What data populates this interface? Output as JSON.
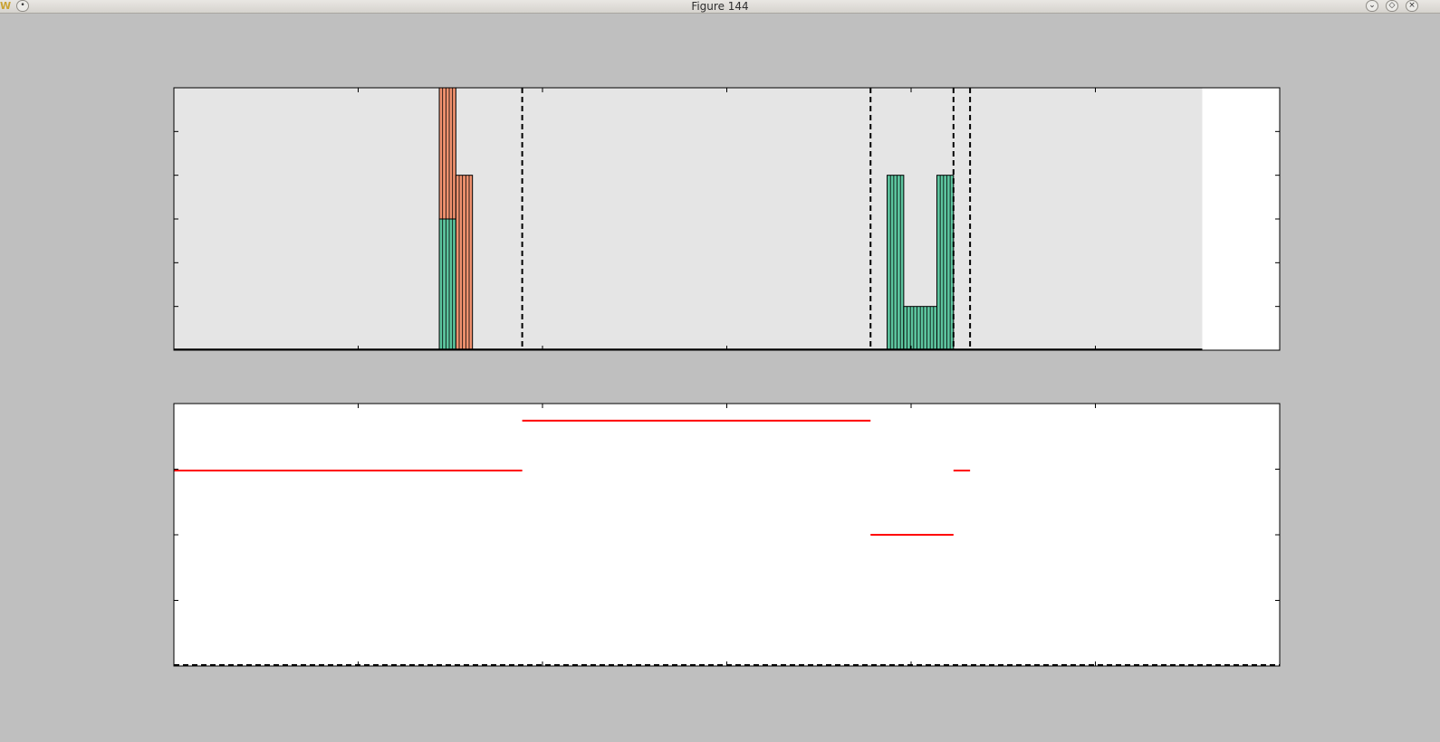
{
  "window": {
    "title": "Figure 144"
  },
  "colors": {
    "figure_bg": "#bfbfbf",
    "upper_axes_bg": "#e5e5e5",
    "coral": "#f0926f",
    "teal": "#5cc49e",
    "red_line": "#ff0000"
  },
  "chart_data": [
    {
      "type": "bar",
      "stacked": true,
      "grid": false,
      "xlim": [
        0,
        120000
      ],
      "ylim": [
        0,
        6000
      ],
      "xticks": [
        "0",
        "20000",
        "40000",
        "60000",
        "80000",
        "100000",
        "120000"
      ],
      "yticks": [
        "0",
        "1000",
        "2000",
        "3000",
        "4000",
        "5000",
        "6000"
      ],
      "shaded_region": [
        0,
        111600
      ],
      "series": [
        {
          "color": "#5cc49e",
          "bars": [
            {
              "x0": 28800,
              "x1": 30600,
              "value": 3000
            },
            {
              "x0": 77400,
              "x1": 79200,
              "value": 4000
            },
            {
              "x0": 79200,
              "x1": 82800,
              "value": 1000
            },
            {
              "x0": 82800,
              "x1": 84600,
              "value": 4000
            }
          ]
        },
        {
          "color": "#f0926f",
          "bars": [
            {
              "x0": 28800,
              "x1": 30600,
              "value": 3000
            },
            {
              "x0": 30600,
              "x1": 32400,
              "value": 4000
            }
          ]
        }
      ],
      "vlines": [
        37800,
        75600,
        84600,
        86400
      ]
    },
    {
      "type": "line",
      "grid": false,
      "xlim": [
        0,
        120000
      ],
      "ylim": [
        0,
        0.2
      ],
      "xticks": [
        "0",
        "20000",
        "40000",
        "60000",
        "80000",
        "100000",
        "120000"
      ],
      "yticks": [
        "0.00",
        "0.05",
        "0.10",
        "0.15",
        "0.20"
      ],
      "segments": [
        {
          "x0": 0,
          "x1": 37800,
          "y": 0.149
        },
        {
          "x0": 37800,
          "x1": 75600,
          "y": 0.187
        },
        {
          "x0": 75600,
          "x1": 84600,
          "y": 0.1
        },
        {
          "x0": 84600,
          "x1": 86400,
          "y": 0.149
        }
      ],
      "baseline_dashed": 0
    }
  ]
}
